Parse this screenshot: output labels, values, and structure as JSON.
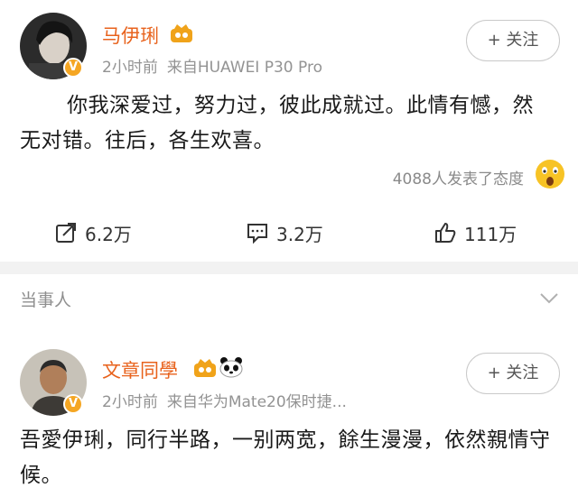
{
  "post1": {
    "author": "马伊琍",
    "time": "2小时前",
    "source": "来自HUAWEI P30 Pro",
    "follow_label": "+ 关注",
    "content": "你我深爱过，努力过，彼此成就过。此情有憾，然无对错。往后，各生欢喜。",
    "reactions_text": "4088人发表了态度",
    "repost_count": "6.2万",
    "comment_count": "3.2万",
    "like_count": "111万"
  },
  "section_label": "当事人",
  "post2": {
    "author": "文章同學",
    "time": "2小时前",
    "source": "来自华为Mate20保时捷...",
    "follow_label": "+ 关注",
    "content": "吾愛伊琍，同行半路，一别两宽，餘生漫漫，依然親情守候。"
  },
  "colors": {
    "name": "#e8621c",
    "verified": "#f5a623",
    "meta": "#939393"
  },
  "icons": [
    "verified-badge-icon",
    "vip-crown-icon",
    "panda-icon",
    "wow-emoji-icon",
    "repost-icon",
    "comment-icon",
    "like-icon",
    "chevron-down-icon"
  ]
}
